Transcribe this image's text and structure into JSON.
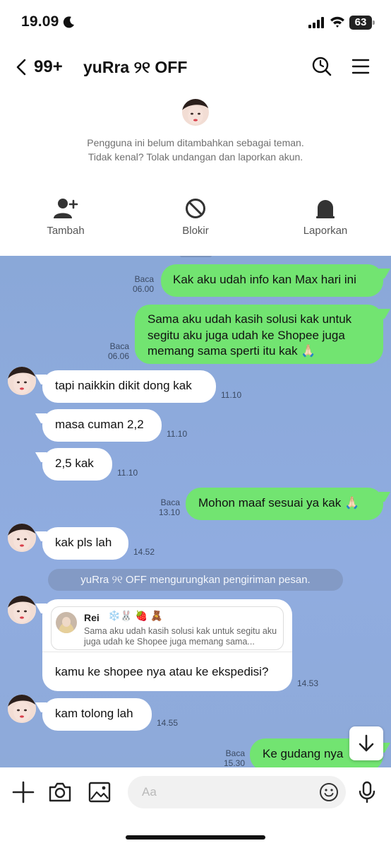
{
  "status_bar": {
    "time": "19.09",
    "battery": "63"
  },
  "header": {
    "back_count": "99+",
    "title": "yuRra ୨୧ OFF"
  },
  "banner": {
    "notice_line1": "Pengguna ini belum ditambahkan sebagai teman.",
    "notice_line2": "Tidak kenal? Tolak undangan dan laporkan akun.",
    "actions": [
      {
        "label": "Tambah",
        "icon": "add-friend-icon"
      },
      {
        "label": "Blokir",
        "icon": "block-icon"
      },
      {
        "label": "Laporkan",
        "icon": "report-icon"
      }
    ]
  },
  "messages": [
    {
      "direction": "out",
      "lines": [
        "Kak aku udah info kan Max hari ini"
      ],
      "read": "Baca",
      "time": "06.00"
    },
    {
      "direction": "out",
      "lines": [
        "Sama aku udah kasih solusi kak untuk",
        "segitu aku juga udah ke Shopee juga",
        "memang sama sperti itu kak 🙏🏻"
      ],
      "read": "Baca",
      "time": "06.06"
    },
    {
      "direction": "in",
      "lines": [
        "tapi naikkin dikit dong kak"
      ],
      "time": "11.10"
    },
    {
      "direction": "in",
      "lines": [
        "masa cuman 2,2"
      ],
      "time": "11.10"
    },
    {
      "direction": "in",
      "lines": [
        "2,5 kak"
      ],
      "time": "11.10"
    },
    {
      "direction": "out",
      "lines": [
        "Mohon maaf sesuai ya kak 🙏🏻"
      ],
      "read": "Baca",
      "time": "13.10"
    },
    {
      "direction": "in",
      "lines": [
        "kak pls lah"
      ],
      "time": "14.52"
    },
    {
      "direction": "in",
      "lines": [
        "kam tolong lah"
      ],
      "time": "14.55"
    },
    {
      "direction": "out",
      "lines": [
        "Ke gudang nya"
      ],
      "read": "Baca",
      "time": "15.30"
    }
  ],
  "system_message": "yuRra ୨୧ OFF mengurungkan pengiriman pesan.",
  "reply": {
    "quoted_name": "Rei",
    "quoted_emoji": "❄️🐰 🍓 🧸",
    "quoted_text": "Sama aku udah kasih solusi kak untuk segitu aku juga udah ke Shopee juga memang sama...",
    "text": "kamu ke shopee nya atau ke ekspedisi?",
    "time": "14.53"
  },
  "input": {
    "placeholder": "Aa"
  },
  "colors": {
    "outgoing_bubble": "#72e471",
    "incoming_bubble": "#ffffff",
    "chat_background": "#8aa8d8"
  }
}
